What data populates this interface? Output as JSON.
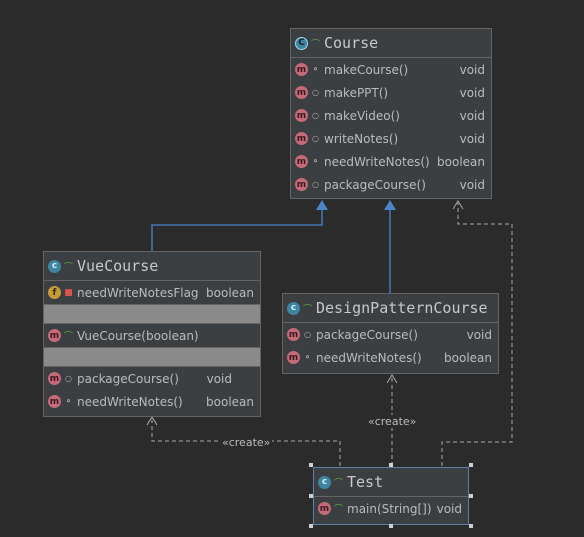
{
  "classes": {
    "course": {
      "name": "Course",
      "icon": "abstract-class-icon",
      "methods": [
        {
          "name": "makeCourse()",
          "type": "void",
          "visibility": "package-key-icon"
        },
        {
          "name": "makePPT()",
          "type": "void",
          "visibility": "package-icon"
        },
        {
          "name": "makeVideo()",
          "type": "void",
          "visibility": "package-icon"
        },
        {
          "name": "writeNotes()",
          "type": "void",
          "visibility": "package-icon"
        },
        {
          "name": "needWriteNotes()",
          "type": "boolean",
          "visibility": "package-key-icon"
        },
        {
          "name": "packageCourse()",
          "type": "void",
          "visibility": "package-icon"
        }
      ]
    },
    "vue": {
      "name": "VueCourse",
      "fields": [
        {
          "name": "needWriteNotesFlag",
          "type": "boolean",
          "visibility": "private-lock-icon"
        }
      ],
      "constructors": [
        {
          "name": "VueCourse(boolean)",
          "type": "",
          "visibility": "public-open-icon"
        }
      ],
      "methods": [
        {
          "name": "packageCourse()",
          "type": "void",
          "visibility": "package-icon"
        },
        {
          "name": "needWriteNotes()",
          "type": "boolean",
          "visibility": "package-key-icon"
        }
      ]
    },
    "design": {
      "name": "DesignPatternCourse",
      "methods": [
        {
          "name": "packageCourse()",
          "type": "void",
          "visibility": "package-icon"
        },
        {
          "name": "needWriteNotes()",
          "type": "boolean",
          "visibility": "package-key-icon"
        }
      ]
    },
    "test": {
      "name": "Test",
      "methods": [
        {
          "name": "main(String[])",
          "type": "void",
          "visibility": "public-open-icon"
        }
      ]
    }
  },
  "edges": {
    "create_label": "«create»"
  },
  "colors": {
    "background": "#2b2b2b",
    "box": "#3c3f41",
    "inheritance": "#4a86c8",
    "dependency": "#a9a9a9"
  }
}
